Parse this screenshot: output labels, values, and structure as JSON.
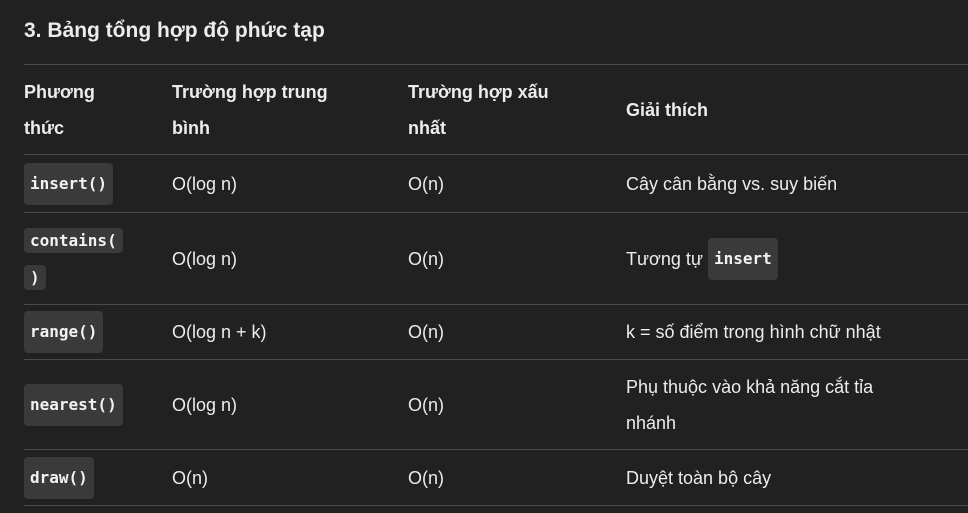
{
  "heading": "3. Bảng tổng hợp độ phức tạp",
  "table": {
    "headers": [
      "Phương thức",
      "Trường hợp trung bình",
      "Trường hợp xấu nhất",
      "Giải thích"
    ],
    "rows": [
      {
        "method": "insert()",
        "avg": "O(log n)",
        "worst": "O(n)",
        "note": "Cây cân bằng vs. suy biến"
      },
      {
        "method_line1": "contains(",
        "method_line2": ")",
        "avg": "O(log n)",
        "worst": "O(n)",
        "note_text": "Tương tự",
        "note_code": "insert"
      },
      {
        "method": "range()",
        "avg": "O(log n + k)",
        "worst": "O(n)",
        "note": "k = số điểm trong hình chữ nhật"
      },
      {
        "method": "nearest()",
        "avg": "O(log n)",
        "worst": "O(n)",
        "note": "Phụ thuộc vào khả năng cắt tỉa nhánh"
      },
      {
        "method": "draw()",
        "avg": "O(n)",
        "worst": "O(n)",
        "note": "Duyệt toàn bộ cây"
      }
    ]
  }
}
